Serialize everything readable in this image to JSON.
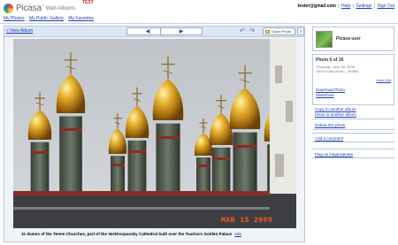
{
  "header": {
    "brand": "Picasa",
    "tm": "™",
    "product": "Web Albums",
    "badge": "TEST",
    "user_email": "tester@gmail.com",
    "sep": "|",
    "links": {
      "help": "Help",
      "settings": "Settings",
      "signout": "Sign Out"
    }
  },
  "nav": {
    "my_photos": "My Photos",
    "public_gallery": "My Public Gallery",
    "favorites": "My Favorites"
  },
  "toolbar": {
    "view_album": "« View Album",
    "prev_glyph": "◀",
    "next_glyph": "▶",
    "share_label": "Share Photo",
    "rotate_left_glyph": "↶",
    "rotate_right_glyph": "↷",
    "magnify_glyph": "⌕"
  },
  "photo": {
    "date_stamp": "MAR 15 2005",
    "caption": "11 domes of the Terem Churches, part of the Verkhospassky Cathedral built over the Tsarina's Golden Palace",
    "edit_link": "edit"
  },
  "sidebar": {
    "username": "Picasa user",
    "photo_num": "Photo 6 of 16",
    "date_line": "Thursday, June 08, 2006",
    "size_line": "1600×1066 pixels – 393KB",
    "more_info": "more info",
    "download": "Download Photo",
    "slideshow": "Slideshow",
    "copy": "Copy to another album",
    "move": "Move to another album",
    "delete": "Delete this photo",
    "add_comment": "Add a comment",
    "flag": "Flag as inappropriate"
  },
  "colors": {
    "link": "#1a3fb8",
    "border": "#b8c6e0",
    "toolbar_bg": "#dde6f5",
    "stamp": "#ff5a1e"
  },
  "icons": [
    "picasa-logo-icon",
    "prev-arrow-icon",
    "next-arrow-icon",
    "rotate-left-icon",
    "rotate-right-icon",
    "share-envelope-icon",
    "magnify-icon"
  ]
}
